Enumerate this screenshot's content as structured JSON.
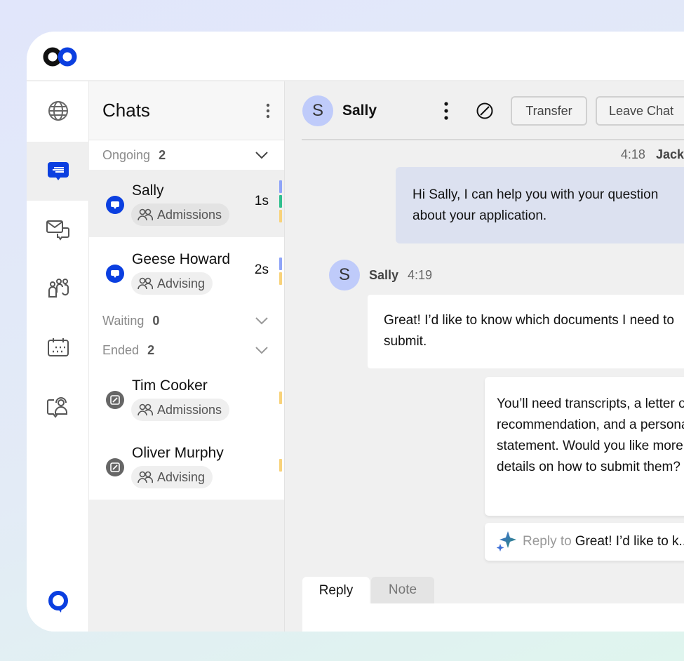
{
  "colors": {
    "brand": "#0b3fe0",
    "avatar": "#bfcbfa",
    "agent_bubble": "#dce1f0",
    "bar_blue": "#8fa4f8",
    "bar_green": "#2fbf8e",
    "bar_yellow": "#f8d27a"
  },
  "sidebar": {
    "items": [
      {
        "icon": "globe-icon"
      },
      {
        "icon": "chat-icon",
        "active": true
      },
      {
        "icon": "messages-icon"
      },
      {
        "icon": "team-icon"
      },
      {
        "icon": "calendar-icon"
      },
      {
        "icon": "agent-icon"
      }
    ],
    "bottom_icon": "brand-chat-icon"
  },
  "chats": {
    "title": "Chats",
    "sections": {
      "ongoing": {
        "label": "Ongoing",
        "count": "2"
      },
      "waiting": {
        "label": "Waiting",
        "count": "0"
      },
      "ended": {
        "label": "Ended",
        "count": "2"
      }
    },
    "ongoing": [
      {
        "name": "Sally",
        "tag": "Admissions",
        "time": "1s"
      },
      {
        "name": "Geese Howard",
        "tag": "Advising",
        "time": "2s"
      }
    ],
    "ended": [
      {
        "name": "Tim Cooker",
        "tag": "Admissions"
      },
      {
        "name": "Oliver Murphy",
        "tag": "Advising"
      }
    ]
  },
  "conversation": {
    "contact_name": "Sally",
    "contact_initial": "S",
    "transfer_label": "Transfer",
    "leave_label": "Leave Chat",
    "messages": [
      {
        "sender": "Jack",
        "time": "4:18",
        "text": "Hi Sally, I can help you with your question about your application."
      },
      {
        "sender": "Sally",
        "initial": "S",
        "time": "4:19",
        "text": "Great! I’d like to know which documents I need to submit."
      }
    ],
    "ai_suggestion": "You’ll need transcripts, a letter of recommendation, and a personal statement. Would you like more details on how to submit them?",
    "reply_to_label": "Reply to",
    "reply_to_text": "Great! I’d like to k...",
    "tabs": [
      "Reply",
      "Note"
    ]
  }
}
